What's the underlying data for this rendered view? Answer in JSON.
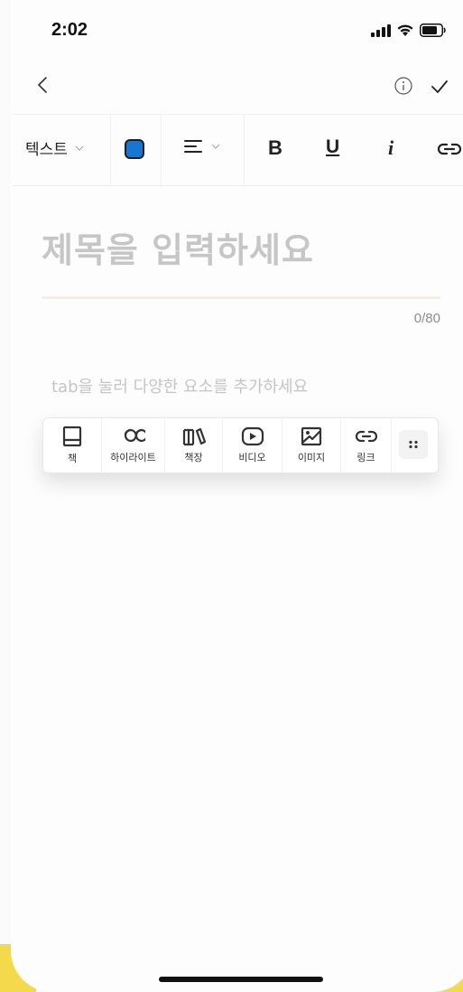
{
  "status_bar": {
    "time": "2:02"
  },
  "nav": {
    "back_icon": "chevron-left-icon",
    "info_icon": "info-icon",
    "confirm_icon": "check-icon"
  },
  "toolbar": {
    "text_style": "텍스트",
    "text_color": "#1876d1",
    "bold": "B",
    "underline": "U",
    "italic": "i"
  },
  "editor": {
    "title_placeholder": "제목을 입력하세요",
    "char_count": "0/80",
    "body_placeholder": "tab을 눌러 다양한 요소를 추가하세요"
  },
  "insert_palette": {
    "items": [
      {
        "label": "책",
        "icon": "book-icon"
      },
      {
        "label": "하이라이트",
        "icon": "quote-icon"
      },
      {
        "label": "책장",
        "icon": "bookshelf-icon"
      },
      {
        "label": "비디오",
        "icon": "video-icon"
      },
      {
        "label": "이미지",
        "icon": "image-icon"
      },
      {
        "label": "링크",
        "icon": "link-icon"
      }
    ],
    "more_icon": "drag-handle-icon"
  },
  "colors": {
    "accent_blue": "#1876d1",
    "placeholder_gray": "#c6c6c6",
    "background_yellow": "#f5d94c"
  }
}
